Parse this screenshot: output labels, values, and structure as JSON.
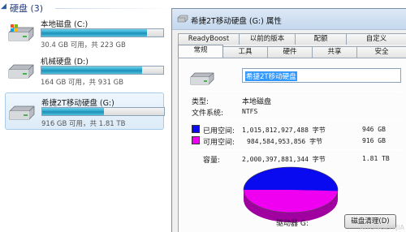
{
  "explorer": {
    "section_title": "硬盘 (3)",
    "drives": [
      {
        "name": "本地磁盘 (C:)",
        "free_text": "30.4 GB 可用，共 223 GB",
        "used_fraction": 0.864,
        "selected": false
      },
      {
        "name": "机械硬盘 (D:)",
        "free_text": "164 GB 可用，共 931 GB",
        "used_fraction": 0.824,
        "selected": false
      },
      {
        "name": "希捷2T移动硬盘 (G:)",
        "free_text": "916 GB 可用，共 1.81 TB",
        "used_fraction": 0.506,
        "selected": true
      }
    ]
  },
  "dialog": {
    "title": "希捷2T移动硬盘 (G:) 属性",
    "tabs_row1": [
      "ReadyBoost",
      "以前的版本",
      "配额",
      "自定义"
    ],
    "tabs_row2": [
      "常规",
      "工具",
      "硬件",
      "共享",
      "安全"
    ],
    "active_tab": "常规",
    "volume_name": "希捷2T移动硬盘",
    "type_label": "类型:",
    "type_value": "本地磁盘",
    "fs_label": "文件系统:",
    "fs_value": "NTFS",
    "used": {
      "label": "已用空间:",
      "bytes": "1,015,812,927,488 字节",
      "size": "946 GB",
      "color": "#0a0af0"
    },
    "free": {
      "label": "可用空间:",
      "bytes": "984,584,953,856 字节",
      "size": "916 GB",
      "color": "#f000f0"
    },
    "capacity": {
      "label": "容量:",
      "bytes": "2,000,397,881,344 字节",
      "size": "1.81 TB"
    },
    "drive_label": "驱动器 G:",
    "cleanup_button": "磁盘清理(D)",
    "used_fraction": 0.508
  },
  "watermark": "XITONGZHIJIA"
}
